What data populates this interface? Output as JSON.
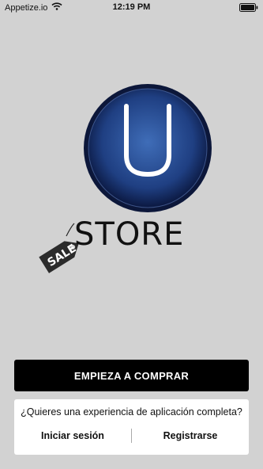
{
  "status_bar": {
    "carrier": "Appetize.io",
    "time": "12:19 PM",
    "wifi_icon": "wifi-icon",
    "battery_icon": "battery-icon"
  },
  "logo": {
    "letter": "U",
    "store_text": "STORE",
    "tag_text": "SALE",
    "colors": {
      "ring_dark": "#0f1f4a",
      "ring_blue": "#2a4f93",
      "letter": "#ffffff"
    }
  },
  "cta": {
    "label": "EMPIEZA A COMPRAR"
  },
  "account": {
    "prompt": "¿Quieres una experiencia de aplicación completa?",
    "login_label": "Iniciar sesión",
    "register_label": "Registrarse"
  }
}
